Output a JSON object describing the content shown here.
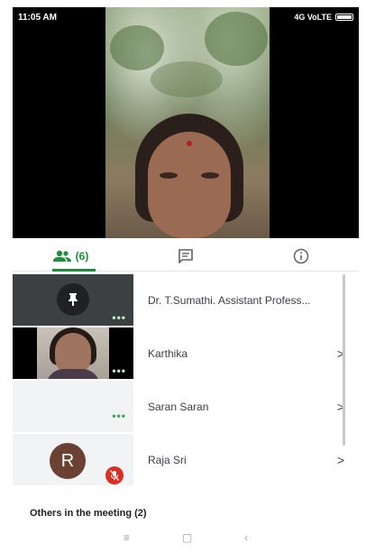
{
  "status_bar": {
    "time": "11:05 AM",
    "network": "4G VoLTE"
  },
  "tabs": [
    {
      "name": "people",
      "count": "(6)",
      "icon": "people-icon",
      "active": true
    },
    {
      "name": "chat",
      "icon": "chat-icon",
      "active": false
    },
    {
      "name": "info",
      "icon": "info-icon",
      "active": false
    }
  ],
  "participants": [
    {
      "name": "Dr. T.Sumathi. Assistant Profess...",
      "tile": "pin-icon",
      "chevron": false
    },
    {
      "name": "Karthika",
      "tile": "video",
      "chevron": true
    },
    {
      "name": "Saran Saran",
      "tile": "blank",
      "chevron": true
    },
    {
      "name": "Raja Sri",
      "tile": "avatar",
      "avatar_letter": "R",
      "muted": true,
      "chevron": true
    }
  ],
  "others_label": "Others in the meeting (2)",
  "nav": {
    "menu": "≡",
    "home": "▢",
    "back": "‹"
  },
  "colors": {
    "accent": "#1e8e3e",
    "tile_bg": "#3c4043",
    "muted_red": "#d93025",
    "avatar_bg": "#6b4134"
  }
}
